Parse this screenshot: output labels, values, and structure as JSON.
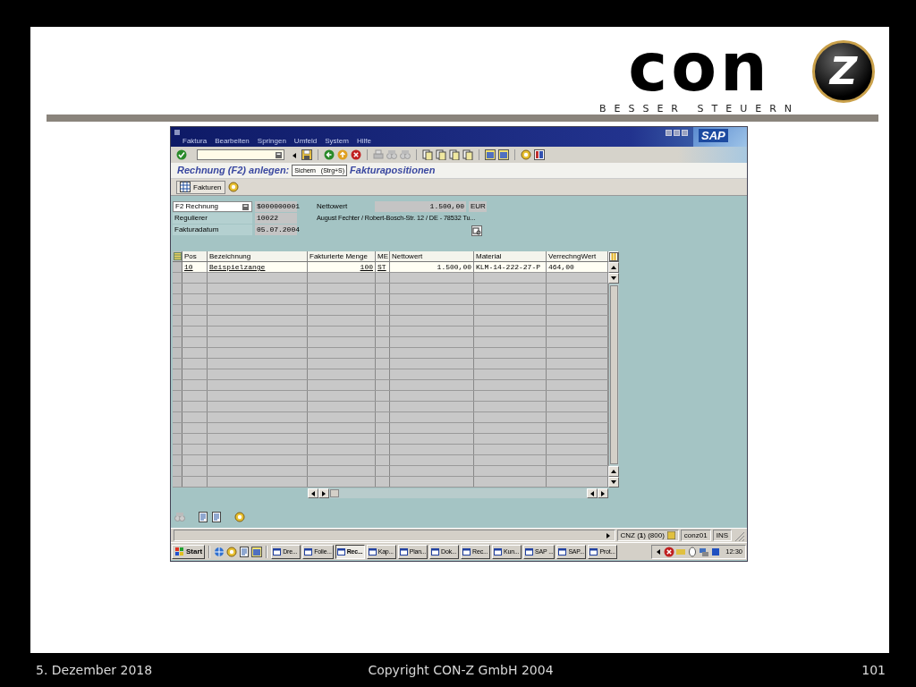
{
  "logo": {
    "wordmark": "con",
    "emblem_letter": "Z",
    "tagline": "BESSER STEUERN"
  },
  "sap": {
    "sap_logo": "SAP",
    "menu": [
      "Faktura",
      "Bearbeiten",
      "Springen",
      "Umfeld",
      "System",
      "Hilfe"
    ],
    "screen_title": {
      "before": "Rechnung  (F2) anlegen:",
      "after": "Fakturapositionen"
    },
    "tooltip": "Sichern   (Strg+S)",
    "app_toolbar": [
      {
        "label": "Fakturen"
      }
    ],
    "header": {
      "billing_type": "F2 Rechnung",
      "document_number": "$000000001",
      "fields": [
        {
          "label": "Regulierer",
          "value": "10022"
        },
        {
          "label": "Fakturadatum",
          "value": "05.07.2004"
        }
      ],
      "net_label": "Nettowert",
      "net_value": "1.500,00",
      "currency": "EUR",
      "address": "August Fechter / Robert-Bosch-Str. 12 / DE - 78532 Tu..."
    },
    "table": {
      "columns": [
        {
          "label": "Pos",
          "kind": "key"
        },
        {
          "label": "Bezeichnung",
          "kind": "key"
        },
        {
          "label": "Fakturierte Menge",
          "kind": "quantity"
        },
        {
          "label": "ME",
          "kind": "key"
        },
        {
          "label": "Nettowert",
          "kind": "amount"
        },
        {
          "label": "Material",
          "kind": "text"
        },
        {
          "label": "VerrechngWert",
          "kind": "text"
        }
      ],
      "rows": [
        [
          "10",
          "Beispielzange",
          "100",
          "ST",
          "1.500,00",
          "KLM-14-222-27-P",
          "464,00"
        ]
      ]
    },
    "status_bar": {
      "system": "CNZ (**1**) (800)",
      "user": "conz01",
      "mode": "INS"
    }
  },
  "taskbar": {
    "start": "Start",
    "buttons": [
      {
        "label": "Dre...",
        "selected": false
      },
      {
        "label": "Folie...",
        "selected": false
      },
      {
        "label": "Rec...",
        "selected": true
      },
      {
        "label": "Kap...",
        "selected": false
      },
      {
        "label": "Plan...",
        "selected": false
      },
      {
        "label": "Dok...",
        "selected": false
      },
      {
        "label": "Rec...",
        "selected": false
      },
      {
        "label": "Kun...",
        "selected": false
      },
      {
        "label": "SAP ...",
        "selected": false
      },
      {
        "label": "SAP...",
        "selected": false
      },
      {
        "label": "Prot...",
        "selected": false
      }
    ],
    "clock": "12:30"
  },
  "footer": {
    "date": "5. Dezember 2018",
    "copyright": "Copyright CON-Z GmbH 2004",
    "page": "101"
  }
}
